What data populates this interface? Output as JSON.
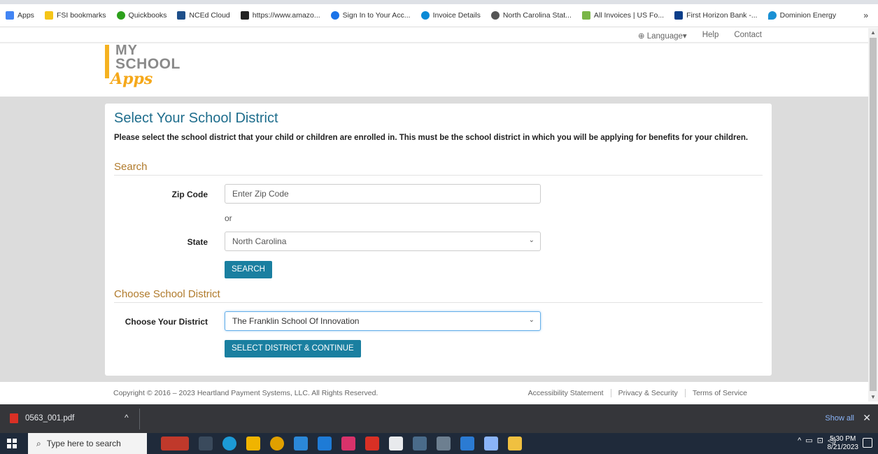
{
  "bookmarks": [
    {
      "label": "Apps",
      "icon": "apps-grid-icon",
      "color": "#4285f4"
    },
    {
      "label": "FSI bookmarks",
      "icon": "folder-icon",
      "color": "#f5c518"
    },
    {
      "label": "Quickbooks",
      "icon": "quickbooks-icon",
      "color": "#2ca01c"
    },
    {
      "label": "NCEd Cloud",
      "icon": "nc-icon",
      "color": "#1e4f8a"
    },
    {
      "label": "https://www.amazo...",
      "icon": "amazon-icon",
      "color": "#222222"
    },
    {
      "label": "Sign In to Your Acc...",
      "icon": "sign-in-icon",
      "color": "#1a73e8"
    },
    {
      "label": "Invoice Details",
      "icon": "invoice-icon",
      "color": "#0b8ad6"
    },
    {
      "label": "North Carolina Stat...",
      "icon": "globe-icon",
      "color": "#555555"
    },
    {
      "label": "All Invoices | US Fo...",
      "icon": "usf-icon",
      "color": "#7ab648"
    },
    {
      "label": "First Horizon Bank -...",
      "icon": "first-horizon-icon",
      "color": "#0b3e8a"
    },
    {
      "label": "Dominion Energy",
      "icon": "flame-icon",
      "color": "#1a90d4"
    }
  ],
  "bookmarks_more": "»",
  "utilnav": {
    "language": "Language",
    "help": "Help",
    "contact": "Contact"
  },
  "logo": {
    "my": "MY",
    "school": "SCHOOL",
    "apps": "Apps"
  },
  "page": {
    "title": "Select Your School District",
    "description": "Please select the school district that your child or children are enrolled in. This must be the school district in which you will be applying for benefits for your children.",
    "search_section": "Search",
    "zip_label": "Zip Code",
    "zip_placeholder": "Enter Zip Code",
    "or": "or",
    "state_label": "State",
    "state_value": "North Carolina",
    "search_button": "SEARCH",
    "district_section": "Choose School District",
    "district_label": "Choose Your District",
    "district_value": "The Franklin School Of Innovation",
    "continue_button": "SELECT DISTRICT & CONTINUE"
  },
  "footer": {
    "copyright": "Copyright © 2016 – 2023 Heartland Payment Systems, LLC. All Rights Reserved.",
    "accessibility": "Accessibility Statement",
    "privacy": "Privacy & Security",
    "terms": "Terms of Service"
  },
  "download": {
    "filename": "0563_001.pdf",
    "show_all": "Show all"
  },
  "taskbar": {
    "search_placeholder": "Type here to search",
    "time": "5:30 PM",
    "date": "8/21/2023"
  }
}
